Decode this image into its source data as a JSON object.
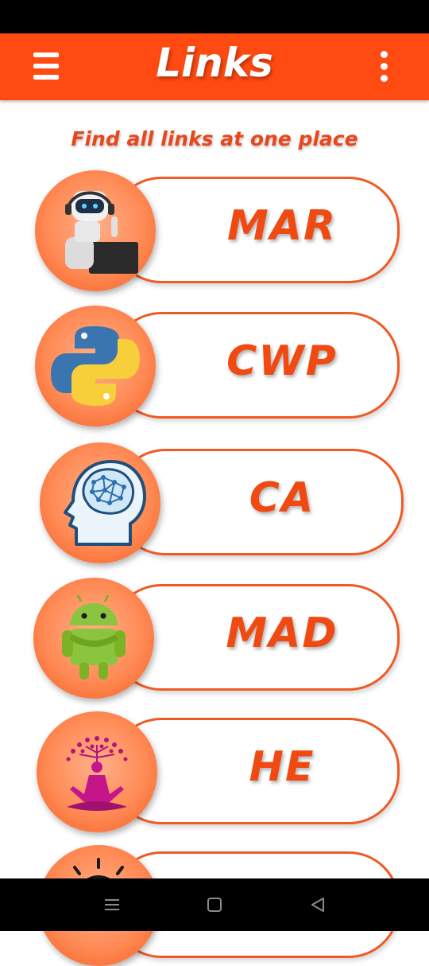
{
  "app_bar": {
    "title": "Links"
  },
  "tagline": "Find all links at one place",
  "links": [
    {
      "label": "MAR",
      "icon": "robot-icon"
    },
    {
      "label": "CWP",
      "icon": "python-logo-icon"
    },
    {
      "label": "CA",
      "icon": "brain-head-icon"
    },
    {
      "label": "MAD",
      "icon": "android-icon"
    },
    {
      "label": "HE",
      "icon": "meditation-icon"
    },
    {
      "label": "",
      "icon": "lightbulb-icon"
    }
  ],
  "colors": {
    "primary": "#FF4A12",
    "accent": "#F05A23",
    "background": "#FFFFFF"
  }
}
